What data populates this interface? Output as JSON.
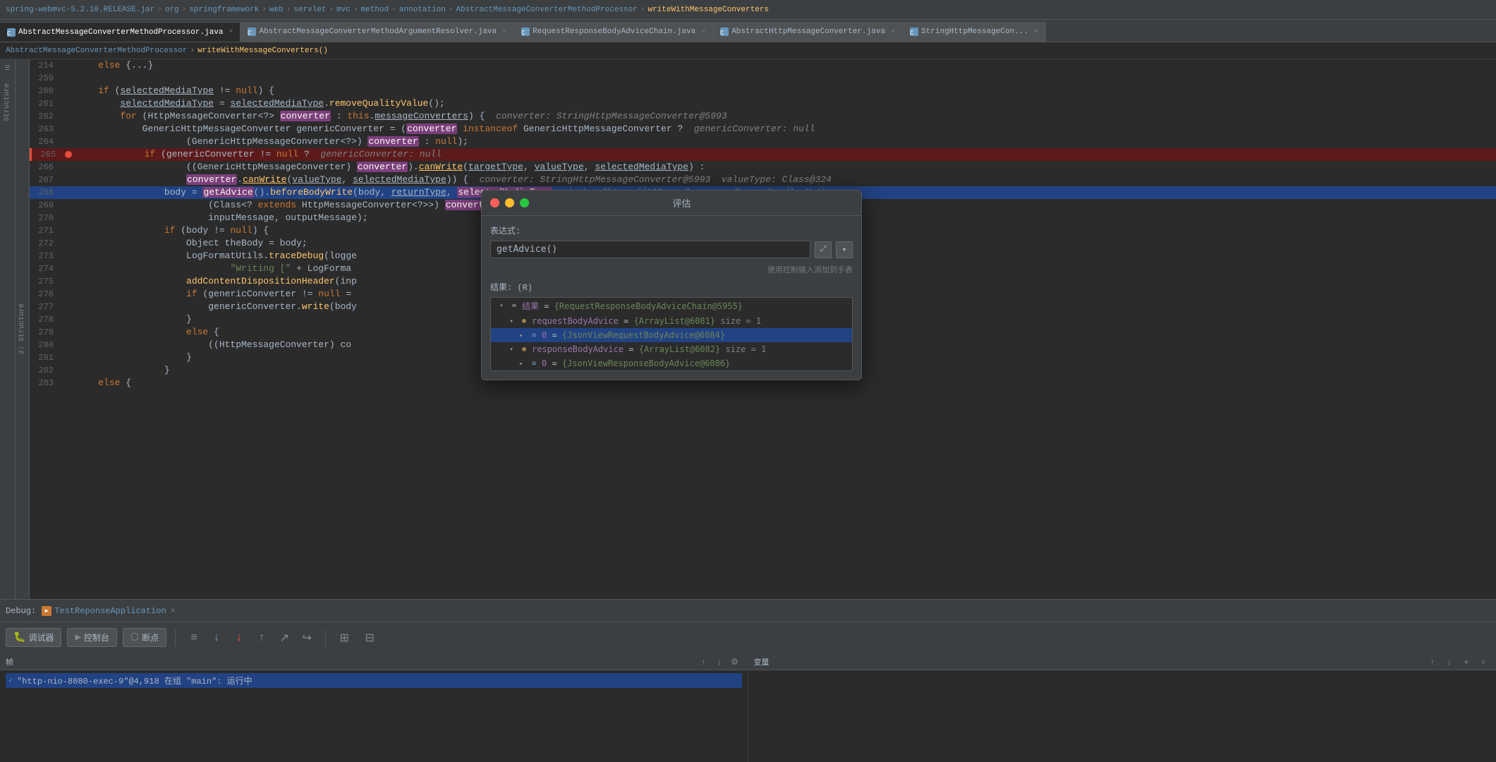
{
  "window": {
    "breadcrumb": [
      {
        "label": "spring-webmvc-5.2.10.RELEASE.jar",
        "active": false
      },
      {
        "label": "org",
        "active": false
      },
      {
        "label": "springframework",
        "active": false
      },
      {
        "label": "web",
        "active": false
      },
      {
        "label": "servlet",
        "active": false
      },
      {
        "label": "mvc",
        "active": false
      },
      {
        "label": "method",
        "active": false
      },
      {
        "label": "annotation",
        "active": false
      },
      {
        "label": "AbstractMessageConverterMethodProcessor",
        "active": false
      },
      {
        "label": "writeWithMessageConverters",
        "active": true
      }
    ]
  },
  "tabs": [
    {
      "label": "AbstractMessageConverterMethodProcessor.java",
      "active": true,
      "color": "#6897bb"
    },
    {
      "label": "AbstractMessageConverterMethodArgumentResolver.java",
      "active": false,
      "color": "#6897bb"
    },
    {
      "label": "RequestResponseBodyAdviceChain.java",
      "active": false,
      "color": "#6897bb"
    },
    {
      "label": "AbstractHttpMessageConverter.java",
      "active": false,
      "color": "#6897bb"
    },
    {
      "label": "StringHttpMessageCon...",
      "active": false,
      "color": "#6897bb"
    }
  ],
  "file_path": {
    "class": "AbstractMessageConverterMethodProcessor",
    "method": "writeWithMessageConverters()"
  },
  "code": {
    "lines": [
      {
        "num": "214",
        "code": "    else {...}",
        "type": "normal"
      },
      {
        "num": "259",
        "code": "",
        "type": "normal"
      },
      {
        "num": "260",
        "code": "    if (selectedMediaType != null) {",
        "type": "normal"
      },
      {
        "num": "261",
        "code": "        selectedMediaType = selectedMediaType.removeQualityValue();",
        "type": "normal"
      },
      {
        "num": "262",
        "code": "        for (HttpMessageConverter<?> converter : this.messageConverters) {  converter: StringHttpMessageConverter@5993",
        "type": "normal"
      },
      {
        "num": "263",
        "code": "            GenericHttpMessageConverter genericConverter = (converter instanceof GenericHttpMessageConverter ?  genericConverter: null",
        "type": "normal"
      },
      {
        "num": "264",
        "code": "                    (GenericHttpMessageConverter<?>) converter : null);",
        "type": "normal"
      },
      {
        "num": "265",
        "code": "            if (genericConverter != null ?  genericConverter: null",
        "type": "error"
      },
      {
        "num": "266",
        "code": "                    ((GenericHttpMessageConverter) converter).canWrite(targetType, valueType, selectedMediaType) :",
        "type": "normal"
      },
      {
        "num": "267",
        "code": "                    converter.canWrite(valueType, selectedMediaType)) {  converter: StringHttpMessageConverter@5993  valueType: Class@324",
        "type": "normal"
      },
      {
        "num": "268",
        "code": "                body = getAdvice().beforeBodyWrite(body, returnType, selectedMediaType,  body: \"http://123.jpg\"  returnType: HandlerMetho",
        "type": "highlighted"
      },
      {
        "num": "269",
        "code": "                        (Class<? extends HttpMessageConverter<?>>) converter.getClass(),",
        "type": "normal"
      },
      {
        "num": "270",
        "code": "                        inputMessage, outputMessage);",
        "type": "normal"
      },
      {
        "num": "271",
        "code": "                if (body != null) {",
        "type": "normal"
      },
      {
        "num": "272",
        "code": "                    Object theBody = body;",
        "type": "normal"
      },
      {
        "num": "273",
        "code": "                    LogFormatUtils.traceDebug(logge",
        "type": "normal"
      },
      {
        "num": "274",
        "code": "                            \"Writing [\" + LogForma",
        "type": "normal"
      },
      {
        "num": "275",
        "code": "                    addContentDispositionHeader(inp",
        "type": "normal"
      },
      {
        "num": "276",
        "code": "                    if (genericConverter != null =",
        "type": "normal"
      },
      {
        "num": "277",
        "code": "                        genericConverter.write(body",
        "type": "normal"
      },
      {
        "num": "278",
        "code": "                    }",
        "type": "normal"
      },
      {
        "num": "279",
        "code": "                    else {",
        "type": "normal"
      },
      {
        "num": "280",
        "code": "                        ((HttpMessageConverter) co",
        "type": "normal"
      },
      {
        "num": "281",
        "code": "                    }",
        "type": "normal"
      },
      {
        "num": "282",
        "code": "                }",
        "type": "normal"
      },
      {
        "num": "283",
        "code": "    else {",
        "type": "normal"
      }
    ]
  },
  "eval_dialog": {
    "title": "评估",
    "expression_label": "表达式:",
    "expression_value": "getAdvice()",
    "hint_text": "使用控制输入添加到手表",
    "result_label": "结果: (R)",
    "expand_icon": "⤢",
    "dropdown_icon": "▾",
    "tree": [
      {
        "level": 0,
        "toggle": "▾",
        "icon": "∞",
        "icon_class": "",
        "selected": false,
        "text": "结果 = {RequestResponseBodyAdviceChain@5955}",
        "key": "结果",
        "val": "{RequestResponseBodyAdviceChain@5955}"
      },
      {
        "level": 1,
        "toggle": "▾",
        "icon": "⊕",
        "icon_class": "ti-orange",
        "selected": false,
        "text": "requestBodyAdvice = {ArrayList@6081}  size = 1",
        "key": "requestBodyAdvice",
        "val": "{ArrayList@6081}",
        "size": "size = 1"
      },
      {
        "level": 2,
        "toggle": "▸",
        "icon": "≡",
        "icon_class": "ti-list",
        "selected": true,
        "text": "0 = {JsonViewRequestBodyAdvice@6084}",
        "key": "0",
        "val": "{JsonViewRequestBodyAdvice@6084}"
      },
      {
        "level": 1,
        "toggle": "▾",
        "icon": "⊕",
        "icon_class": "ti-orange",
        "selected": false,
        "text": "responseBodyAdvice = {ArrayList@6082}  size = 1",
        "key": "responseBodyAdvice",
        "val": "{ArrayList@6082}",
        "size": "size = 1"
      },
      {
        "level": 2,
        "toggle": "▸",
        "icon": "≡",
        "icon_class": "ti-list",
        "selected": false,
        "text": "0 = {JsonViewResponseBodyAdvice@6086}",
        "key": "0",
        "val": "{JsonViewResponseBodyAdvice@6086}"
      }
    ]
  },
  "debug_bar": {
    "label": "Debug:",
    "app_name": "TestReponseApplication",
    "close_icon": "×"
  },
  "debug_tools": [
    {
      "id": "debugger",
      "label": "调试器",
      "icon": "🐛"
    },
    {
      "id": "console",
      "label": "控制台",
      "icon": "▶"
    },
    {
      "id": "breakpoints",
      "label": "断点",
      "icon": "⬡"
    },
    {
      "id": "nav1",
      "label": "",
      "icon": "≡"
    },
    {
      "id": "nav_down_blue",
      "label": "",
      "icon": "↓"
    },
    {
      "id": "nav_down_red",
      "label": "",
      "icon": "↓"
    },
    {
      "id": "nav_up",
      "label": "",
      "icon": "↑"
    },
    {
      "id": "nav_step",
      "label": "",
      "icon": "↗"
    },
    {
      "id": "nav_arrow",
      "label": "",
      "icon": "↪"
    },
    {
      "id": "table",
      "label": "",
      "icon": "⊞"
    },
    {
      "id": "calc",
      "label": "",
      "icon": "⊟"
    }
  ],
  "bottom_panels": {
    "frames_label": "帧",
    "variables_label": "变量",
    "frame_entry": "\"http-nio-8080-exec-9\"@4,918 在组 \"main\": 运行中",
    "nav_up_icon": "↑",
    "nav_down_icon": "↓",
    "nav_plus_icon": "+",
    "nav_right_icon": ">"
  }
}
